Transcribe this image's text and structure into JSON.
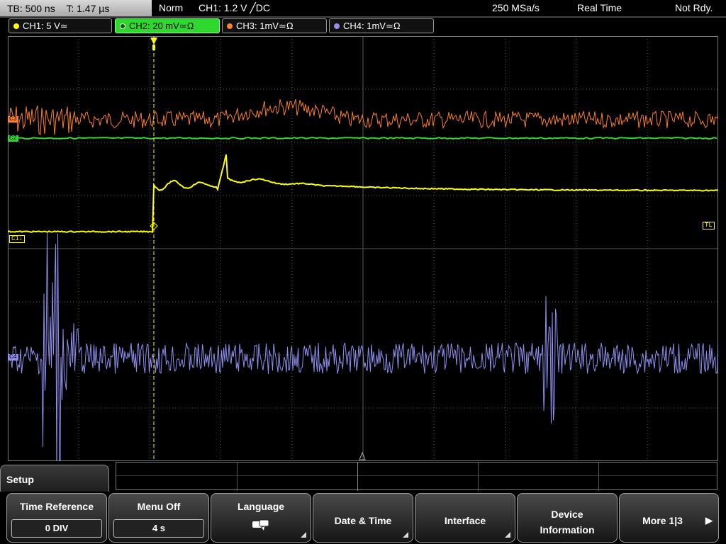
{
  "status": {
    "timebase": "TB: 500 ns",
    "trigger_time": "T: 1.47 µs",
    "mode": "Norm",
    "trigger_source": "CH1: 1.2 V ╱DC",
    "sample_rate": "250 MSa/s",
    "acq_mode": "Real Time",
    "ready_state": "Not Rdy."
  },
  "channels": [
    {
      "label": "CH1: 5 V≃",
      "color": "#ffff00",
      "active": false
    },
    {
      "label": "CH2: 20 mV≃Ω",
      "color": "#30d830",
      "active": true
    },
    {
      "label": "CH3: 1mV≃Ω",
      "color": "#ff7f27",
      "active": false
    },
    {
      "label": "CH4: 1mV≃Ω",
      "color": "#8f8ff0",
      "active": false
    }
  ],
  "markers": {
    "ch1": "C1↓",
    "trigger_level": "TL",
    "ch2": "C2",
    "ch3": "C3",
    "ch4": "C4"
  },
  "menu": {
    "title": "Setup",
    "softkeys": [
      {
        "label": "Time Reference",
        "value": "0 DIV"
      },
      {
        "label": "Menu Off",
        "value": "4 s"
      },
      {
        "label": "Language",
        "icon": "speech-bubble-icon"
      },
      {
        "label": "Date & Time"
      },
      {
        "label": "Interface"
      },
      {
        "label_line1": "Device",
        "label_line2": "Information"
      },
      {
        "label": "More 1|3"
      }
    ]
  },
  "colors": {
    "ch1": "#ffff00",
    "ch2": "#2ed82e",
    "ch3": "#ff7f27",
    "ch4": "#8f8ff0",
    "grid": "#5a5a5a"
  }
}
